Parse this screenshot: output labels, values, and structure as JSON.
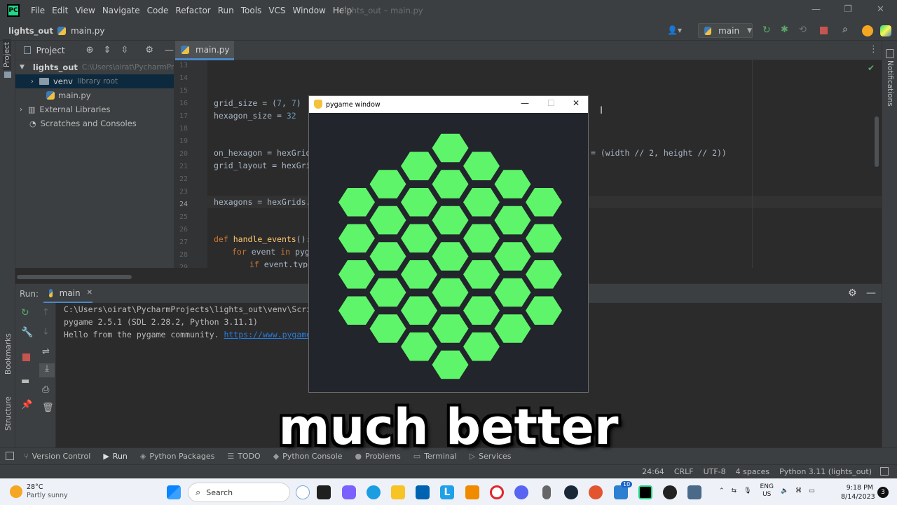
{
  "window_title": "lights_out – main.py",
  "menu": [
    "File",
    "Edit",
    "View",
    "Navigate",
    "Code",
    "Refactor",
    "Run",
    "Tools",
    "VCS",
    "Window",
    "Help"
  ],
  "breadcrumb": {
    "project": "lights_out",
    "file": "main.py"
  },
  "run_config": "main",
  "project_panel": {
    "title": "Project",
    "root": "lights_out",
    "root_path": "C:\\Users\\oirat\\PycharmPr",
    "venv": "venv",
    "venv_note": "library root",
    "main_file": "main.py",
    "ext_libs": "External Libraries",
    "scratches": "Scratches and Consoles"
  },
  "editor": {
    "tab": "main.py",
    "line_numbers": [
      "13",
      "14",
      "15",
      "16",
      "17",
      "18",
      "19",
      "20",
      "21",
      "22",
      "23",
      "24",
      "25",
      "26",
      "27",
      "28",
      "29"
    ],
    "lines": {
      "grid_size": [
        "grid_size = (",
        "7",
        ", ",
        "7",
        ")"
      ],
      "hexagon_size": [
        "hexagon_size = ",
        "32"
      ],
      "on_hexagon": "on_hexagon = hexGrids",
      "grid_layout": "grid_layout = hexGrid",
      "hexagons": "hexagons = hexGrids.g",
      "def_kw": "def",
      "handle_events": "handle_events",
      "def_rest": "():",
      "for_kw": "for",
      "for_rest": " event ",
      "in_kw": "in",
      "for_tail": " pyga",
      "if_kw": "if",
      "if_rest": " event.type",
      "offscreen_tail": "= (width // 2, height // 2))"
    }
  },
  "run_panel": {
    "label": "Run:",
    "tab": "main",
    "console": [
      "C:\\Users\\oirat\\PycharmProjects\\lights_out\\venv\\Scripts\\",
      "pygame 2.5.1 (SDL 2.28.2, Python 3.11.1)",
      "Hello from the pygame community. "
    ],
    "link": "https://www.pygame.org"
  },
  "left_stripe": {
    "project": "Project",
    "bookmarks": "Bookmarks",
    "structure": "Structure"
  },
  "right_stripe": {
    "notifications": "Notifications"
  },
  "bottom_tools": [
    "Version Control",
    "Run",
    "Python Packages",
    "TODO",
    "Python Console",
    "Problems",
    "Terminal",
    "Services"
  ],
  "status": {
    "position": "24:64",
    "line_sep": "CRLF",
    "encoding": "UTF-8",
    "indent": "4 spaces",
    "interpreter": "Python 3.11 (lights_out)"
  },
  "pygame_window": {
    "title": "pygame window",
    "hex_color": "#5ef56a",
    "bg_color": "#22252b",
    "hex_columns": [
      4,
      5,
      6,
      7,
      6,
      5,
      4
    ]
  },
  "subtitle": "much better",
  "taskbar": {
    "temp": "28°C",
    "weather": "Partly sunny",
    "search_placeholder": "Search",
    "lang": "ENG",
    "region": "US",
    "time": "9:18 PM",
    "date": "8/14/2023",
    "badge": "10"
  },
  "colors": {
    "ide_bg": "#2b2b2b",
    "ide_panel": "#3c3f41",
    "keyword": "#cc7832",
    "number": "#6897bb",
    "function": "#ffc66d",
    "link": "#287bde",
    "run_green": "#59a869",
    "stop_red": "#c75450"
  }
}
